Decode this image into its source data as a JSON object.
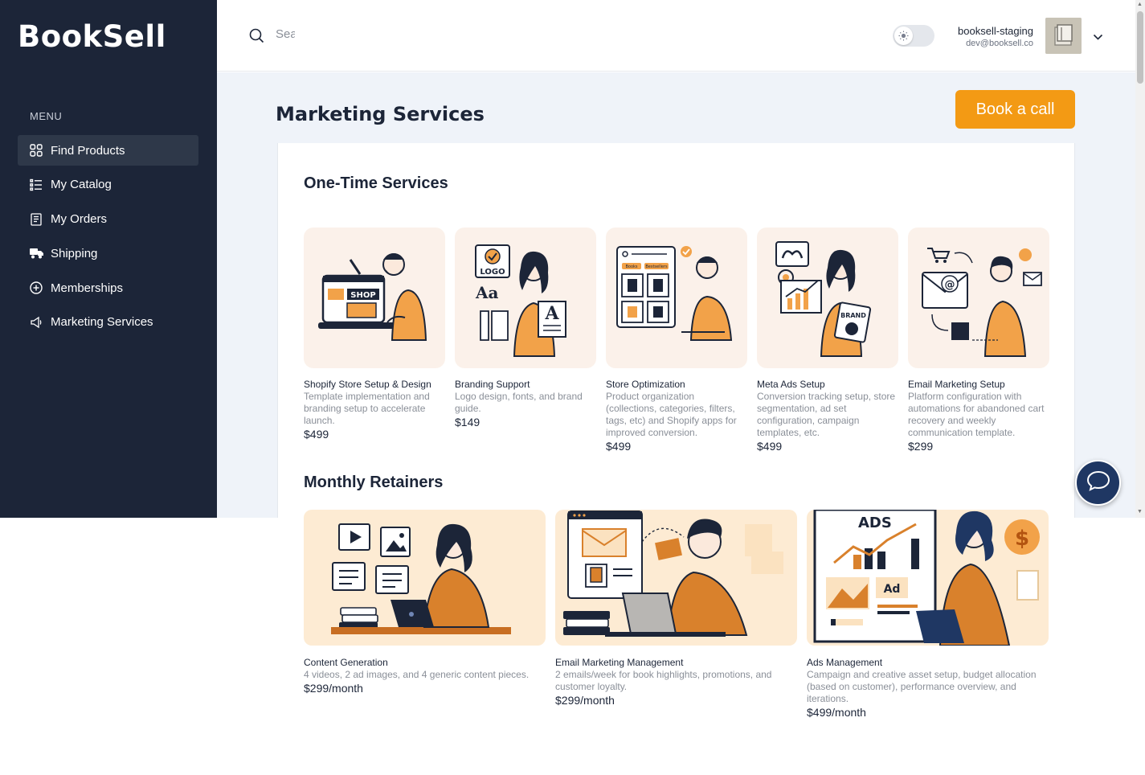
{
  "brand": {
    "name": "BookSell"
  },
  "sidebar": {
    "menu_label": "MENU",
    "items": [
      {
        "label": "Find Products",
        "icon": "grid-icon",
        "active": true
      },
      {
        "label": "My Catalog",
        "icon": "list-icon"
      },
      {
        "label": "My Orders",
        "icon": "receipt-icon"
      },
      {
        "label": "Shipping",
        "icon": "truck-icon"
      },
      {
        "label": "Memberships",
        "icon": "plus-circle-icon"
      },
      {
        "label": "Marketing Services",
        "icon": "megaphone-icon"
      }
    ]
  },
  "header": {
    "search_placeholder": "Search",
    "user_name": "booksell-staging",
    "user_email": "dev@booksell.co"
  },
  "page": {
    "title": "Marketing Services",
    "cta_label": "Book a call"
  },
  "one_time": {
    "title": "One-Time Services",
    "items": [
      {
        "name": "Shopify Store Setup & Design",
        "desc": "Template implementation and branding setup to accelerate launch.",
        "price": "$499"
      },
      {
        "name": "Branding Support",
        "desc": "Logo design, fonts, and brand guide.",
        "price": "$149"
      },
      {
        "name": "Store Optimization",
        "desc": "Product organization (collections, categories, filters, tags, etc) and Shopify apps for improved conversion.",
        "price": "$499"
      },
      {
        "name": "Meta Ads Setup",
        "desc": "Conversion tracking setup, store segmentation, ad set configuration, campaign templates, etc.",
        "price": "$499"
      },
      {
        "name": "Email Marketing Setup",
        "desc": "Platform configuration with automations for abandoned cart recovery and weekly communication template.",
        "price": "$299"
      }
    ]
  },
  "retainers": {
    "title": "Monthly Retainers",
    "items": [
      {
        "name": "Content Generation",
        "desc": "4 videos, 2 ad images, and 4 generic content pieces.",
        "price": "$299/month"
      },
      {
        "name": "Email Marketing Management",
        "desc": "2 emails/week for book highlights, promotions, and customer loyalty.",
        "price": "$299/month"
      },
      {
        "name": "Ads Management",
        "desc": "Campaign and creative asset setup, budget allocation (based on customer), performance overview, and iterations.",
        "price": "$499/month"
      }
    ]
  },
  "illustrations": {
    "shop_label": "SHOP",
    "logo_label": "LOGO",
    "font_label": "Aa",
    "letter_label": "A",
    "books_label": "Books",
    "bestsellers_label": "Bestsellers",
    "brand_label": "BRAND",
    "at_label": "@",
    "ads_label": "ADS",
    "ad_label": "Ad",
    "dollar_label": "$"
  },
  "colors": {
    "sidebar": "#1c2538",
    "accent": "#f39a14",
    "chat": "#1f3763"
  }
}
